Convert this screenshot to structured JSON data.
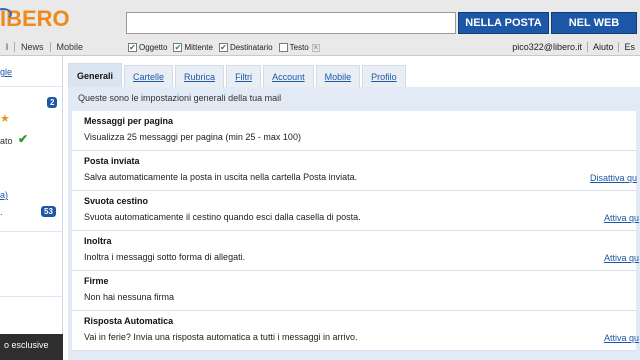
{
  "header": {
    "logo": "IBERO",
    "search": {
      "value": "",
      "placeholder": ""
    },
    "btn_nella_posta": "NELLA POSTA",
    "btn_nel_web": "NEL WEB"
  },
  "nav": {
    "links": [
      "l",
      "News",
      "Mobile"
    ],
    "filters": [
      {
        "label": "Oggetto",
        "checked": true
      },
      {
        "label": "Mittente",
        "checked": true
      },
      {
        "label": "Destinatario",
        "checked": true
      },
      {
        "label": "Testo",
        "checked": false
      }
    ],
    "user_email": "pico322@libero.it",
    "help": "Aiuto",
    "esc": "Es"
  },
  "sidebar": {
    "link_top": "gle",
    "badge_1": "2",
    "text_ato": "ato",
    "link_a": "a)",
    "badge_2": "53",
    "dark_text": "o esclusive"
  },
  "tabs": [
    "Generali",
    "Cartelle",
    "Rubrica",
    "Filtri",
    "Account",
    "Mobile",
    "Profilo"
  ],
  "active_tab": "Generali",
  "intro": "Queste sono le impostazioni generali della tua mail",
  "sections": [
    {
      "title": "Messaggi per pagina",
      "desc": "Visualizza 25 messaggi per pagina (min 25 - max 100)",
      "action": ""
    },
    {
      "title": "Posta inviata",
      "desc": "Salva automaticamente la posta in uscita nella cartella Posta inviata.",
      "action": "Disattiva qu"
    },
    {
      "title": "Svuota cestino",
      "desc": "Svuota automaticamente il cestino quando esci dalla casella di posta.",
      "action": "Attiva qu"
    },
    {
      "title": "Inoltra",
      "desc": "Inoltra i messaggi sotto forma di allegati.",
      "action": "Attiva qu"
    },
    {
      "title": "Firme",
      "desc": "Non hai nessuna firma",
      "action": ""
    },
    {
      "title": "Risposta Automatica",
      "desc": "Vai in ferie? Invia una risposta automatica a tutti i messaggi in arrivo.",
      "action": "Attiva qu"
    }
  ]
}
